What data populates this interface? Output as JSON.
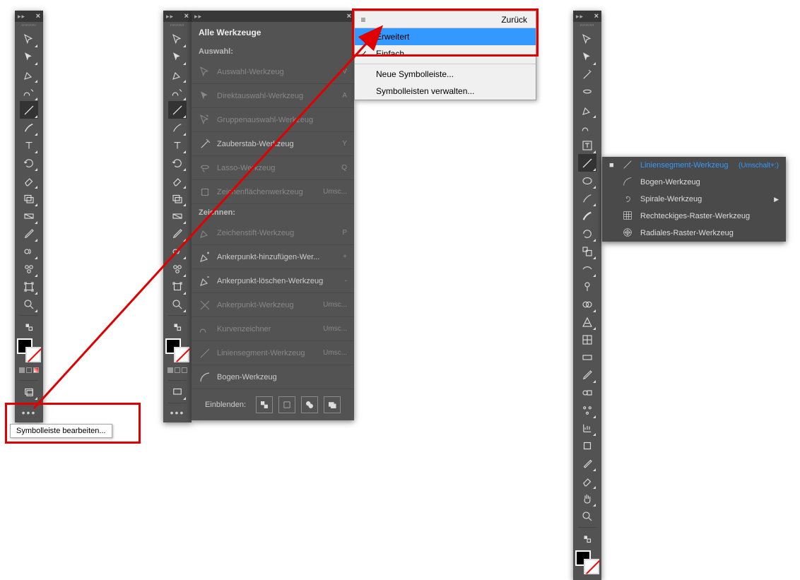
{
  "toolbar1": {
    "tooltip": "Symbolleiste bearbeiten..."
  },
  "expanded": {
    "title": "Alle Werkzeuge",
    "section_selection": "Auswahl:",
    "section_draw": "Zeichnen:",
    "tools_sel": [
      {
        "name": "Auswahl-Werkzeug",
        "key": "V",
        "dim": true
      },
      {
        "name": "Direktauswahl-Werkzeug",
        "key": "A",
        "dim": true
      },
      {
        "name": "Gruppenauswahl-Werkzeug",
        "key": "",
        "dim": true
      },
      {
        "name": "Zauberstab-Werkzeug",
        "key": "Y",
        "dim": false
      },
      {
        "name": "Lasso-Werkzeug",
        "key": "Q",
        "dim": true
      },
      {
        "name": "Zeichenflächenwerkzeug",
        "key": "Umsc...",
        "dim": true
      }
    ],
    "tools_draw": [
      {
        "name": "Zeichenstift-Werkzeug",
        "key": "P",
        "dim": true
      },
      {
        "name": "Ankerpunkt-hinzufügen-Wer...",
        "key": "+",
        "dim": false
      },
      {
        "name": "Ankerpunkt-löschen-Werkzeug",
        "key": "-",
        "dim": false
      },
      {
        "name": "Ankerpunkt-Werkzeug",
        "key": "Umsc...",
        "dim": true
      },
      {
        "name": "Kurvenzeichner",
        "key": "Umsc...",
        "dim": true
      },
      {
        "name": "Liniensegment-Werkzeug",
        "key": "Umsc...",
        "dim": true
      },
      {
        "name": "Bogen-Werkzeug",
        "key": "",
        "dim": false
      }
    ],
    "footer_label": "Einblenden:"
  },
  "dropdown": {
    "back": "Zurück",
    "items": [
      {
        "label": "Erweitert",
        "hl": true,
        "chk": false
      },
      {
        "label": "Einfach",
        "hl": false,
        "chk": true
      }
    ],
    "items2": [
      {
        "label": "Neue Symbolleiste..."
      },
      {
        "label": "Symbolleisten verwalten..."
      }
    ]
  },
  "flyout": {
    "items": [
      {
        "name": "Liniensegment-Werkzeug",
        "shortcut": "(Umschalt+:)",
        "active": true
      },
      {
        "name": "Bogen-Werkzeug",
        "shortcut": ""
      },
      {
        "name": "Spirale-Werkzeug",
        "shortcut": "",
        "arrow": true
      },
      {
        "name": "Rechteckiges-Raster-Werkzeug",
        "shortcut": ""
      },
      {
        "name": "Radiales-Raster-Werkzeug",
        "shortcut": ""
      }
    ]
  }
}
